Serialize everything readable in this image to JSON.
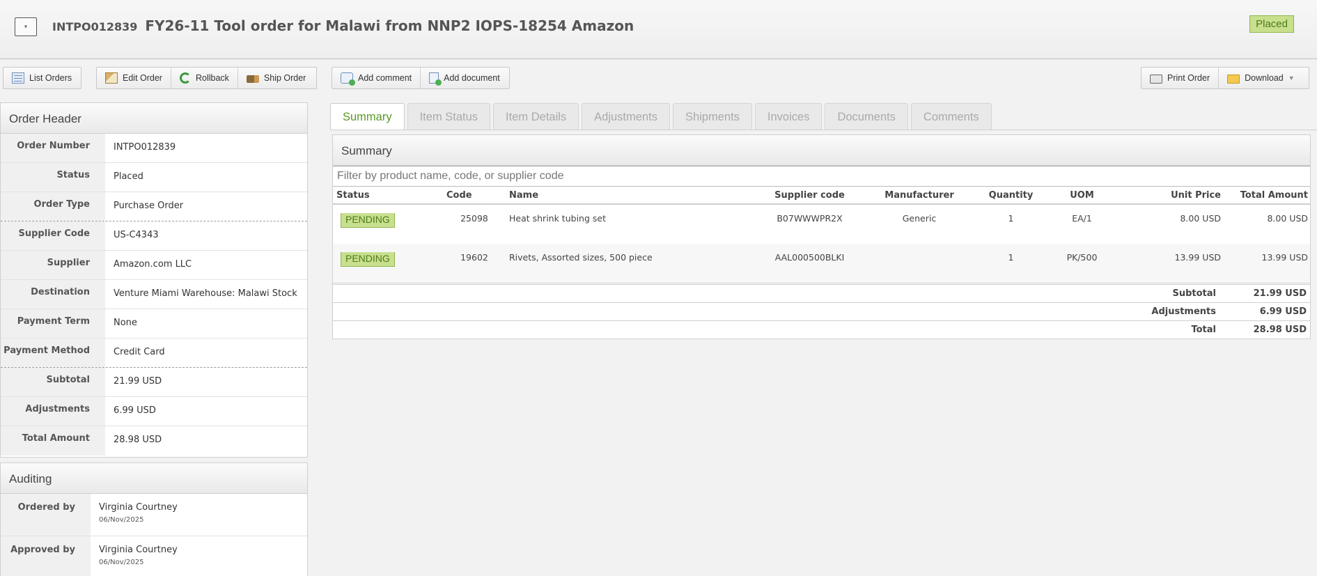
{
  "header": {
    "toggle_icon": "▾",
    "po_number": "INTPO012839",
    "title": "FY26-11 Tool order for Malawi from NNP2 IOPS-18254 Amazon",
    "status": "Placed"
  },
  "toolbar": {
    "list_orders": "List Orders",
    "edit_order": "Edit Order",
    "rollback": "Rollback",
    "ship_order": "Ship Order",
    "add_comment": "Add comment",
    "add_document": "Add document",
    "print_order": "Print Order",
    "download": "Download",
    "download_caret": "▼"
  },
  "order_header": {
    "title": "Order Header",
    "rows": [
      {
        "label": "Order Number",
        "value": "INTPO012839"
      },
      {
        "label": "Status",
        "value": "Placed"
      },
      {
        "label": "Order Type",
        "value": "Purchase Order"
      },
      {
        "label": "Supplier Code",
        "value": "US-C4343"
      },
      {
        "label": "Supplier",
        "value": "Amazon.com LLC"
      },
      {
        "label": "Destination",
        "value": "Venture Miami Warehouse: Malawi Stock"
      },
      {
        "label": "Payment Term",
        "value": "None"
      },
      {
        "label": "Payment Method",
        "value": "Credit Card"
      },
      {
        "label": "Subtotal",
        "value": "21.99 USD"
      },
      {
        "label": "Adjustments",
        "value": "6.99 USD"
      },
      {
        "label": "Total Amount",
        "value": "28.98 USD"
      }
    ]
  },
  "auditing": {
    "title": "Auditing",
    "rows": [
      {
        "label": "Ordered by",
        "name": "Virginia Courtney",
        "date": "06/Nov/2025"
      },
      {
        "label": "Approved by",
        "name": "Virginia Courtney",
        "date": "06/Nov/2025"
      }
    ]
  },
  "tabs": [
    "Summary",
    "Item Status",
    "Item Details",
    "Adjustments",
    "Shipments",
    "Invoices",
    "Documents",
    "Comments"
  ],
  "summary": {
    "title": "Summary",
    "filter_placeholder": "Filter by product name, code, or supplier code",
    "columns": [
      "Status",
      "Code",
      "Name",
      "Supplier code",
      "Manufacturer",
      "Quantity",
      "UOM",
      "Unit Price",
      "Total Amount"
    ],
    "rows": [
      {
        "status": "PENDING",
        "code": "25098",
        "name": "Heat shrink tubing set",
        "supplier_code": "B07WWWPR2X",
        "manufacturer": "Generic",
        "quantity": "1",
        "uom": "EA/1",
        "unit_price": "8.00 USD",
        "total": "8.00 USD"
      },
      {
        "status": "PENDING",
        "code": "19602",
        "name": "Rivets, Assorted sizes, 500 piece",
        "supplier_code": "AAL000500BLKI",
        "manufacturer": "",
        "quantity": "1",
        "uom": "PK/500",
        "unit_price": "13.99 USD",
        "total": "13.99 USD"
      }
    ],
    "totals": [
      {
        "label": "Subtotal",
        "value": "21.99 USD"
      },
      {
        "label": "Adjustments",
        "value": "6.99 USD"
      },
      {
        "label": "Total",
        "value": "28.98 USD"
      }
    ]
  }
}
